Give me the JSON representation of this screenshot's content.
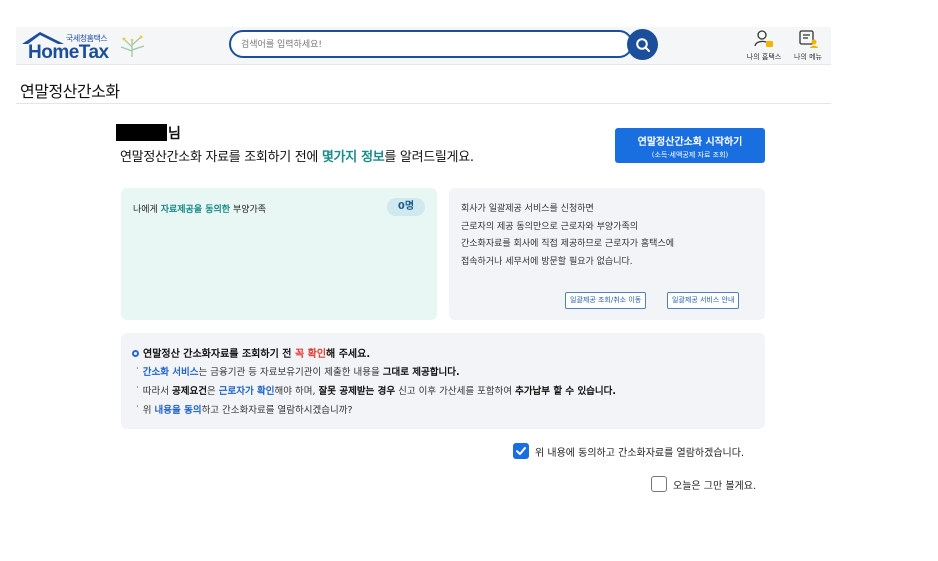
{
  "header": {
    "logo_sub": "국세청홈택스",
    "logo_main": "HomeTax",
    "search_placeholder": "검색어를 입력하세요!",
    "my_hometax": "나의 홈택스",
    "my_menu": "나의 메뉴"
  },
  "page": {
    "title": "연말정산간소화"
  },
  "greeting": {
    "suffix": "님",
    "intro_before": "연말정산간소화 자료를 조회하기 전에 ",
    "intro_em": "몇가지 정보",
    "intro_after": "를 알려드릴게요."
  },
  "start_button": {
    "line1": "연말정산간소화 시작하기",
    "line2": "(소득·세액공제 자료 조회)"
  },
  "consent_panel": {
    "label_before": "나에게 ",
    "label_em": "자료제공을 동의한",
    "label_after": " 부양가족",
    "count": "0명"
  },
  "bulk_panel": {
    "lines": [
      "회사가 일괄제공 서비스를 신청하면",
      "근로자의 제공 동의만으로 근로자와 부양가족의",
      "간소화자료를 회사에 직접 제공하므로 근로자가 홈택스에",
      "접속하거나 세무서에 방문할 필요가 없습니다."
    ],
    "link1": "일괄제공 조회/취소 이동",
    "link2": "일괄제공 서비스 안내"
  },
  "notice": {
    "head_before": "연말정산 간소화자료를 조회하기 전 ",
    "head_red": "꼭 확인",
    "head_after": "해 주세요.",
    "l1_blue": "간소화 서비스",
    "l1_mid": "는 금융기관 등 자료보유기관이 제출한 내용을 ",
    "l1_bold": "그대로 제공합니다.",
    "l2_a": "따라서 ",
    "l2_b": "공제요건",
    "l2_c": "은 ",
    "l2_d": "근로자가 확인",
    "l2_e": "해야 하며, ",
    "l2_f": "잘못 공제받는 경우",
    "l2_g": " 신고 이후 가산세를 포함하여 ",
    "l2_h": "추가납부 할 수 있습니다.",
    "l3_a": "위 ",
    "l3_b": "내용을 동의",
    "l3_c": "하고 간소화자료를 열람하시겠습니까?"
  },
  "checks": {
    "agree_label": "위 내용에 동의하고 간소화자료를 열람하겠습니다.",
    "agree_checked": true,
    "hide_label": "오늘은 그만 볼게요.",
    "hide_checked": false
  },
  "colors": {
    "brand": "#1b4f9c",
    "primary_button": "#1a6fe0",
    "accent_teal": "#1a8a8a",
    "warning_red": "#e03c31"
  }
}
